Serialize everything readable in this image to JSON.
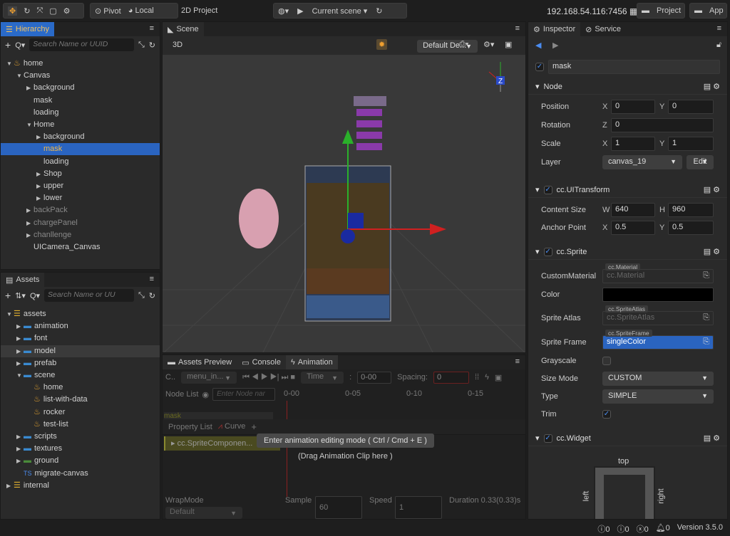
{
  "toolbar": {
    "pivot": "Pivot",
    "local": "Local",
    "project_type": "2D Project",
    "scene_select": "Current scene",
    "ip": "192.168.54.116:7456",
    "project_btn": "Project",
    "app_btn": "App"
  },
  "hierarchy": {
    "tab": "Hierarchy",
    "search_placeholder": "Search Name or UUID",
    "items": [
      {
        "label": "home",
        "depth": 0,
        "arrow": "down",
        "icon": true
      },
      {
        "label": "Canvas",
        "depth": 1,
        "arrow": "down"
      },
      {
        "label": "background",
        "depth": 2,
        "arrow": "right"
      },
      {
        "label": "mask",
        "depth": 2
      },
      {
        "label": "loading",
        "depth": 2
      },
      {
        "label": "Home",
        "depth": 2,
        "arrow": "down"
      },
      {
        "label": "background",
        "depth": 3,
        "arrow": "right"
      },
      {
        "label": "mask",
        "depth": 3,
        "selected": true
      },
      {
        "label": "loading",
        "depth": 3
      },
      {
        "label": "Shop",
        "depth": 3,
        "arrow": "right"
      },
      {
        "label": "upper",
        "depth": 3,
        "arrow": "right"
      },
      {
        "label": "lower",
        "depth": 3,
        "arrow": "right"
      },
      {
        "label": "backPack",
        "depth": 2,
        "arrow": "right",
        "dim": true
      },
      {
        "label": "chargePanel",
        "depth": 2,
        "arrow": "right",
        "dim": true
      },
      {
        "label": "chanllenge",
        "depth": 2,
        "arrow": "right",
        "dim": true
      },
      {
        "label": "UICamera_Canvas",
        "depth": 2
      }
    ]
  },
  "assets": {
    "tab": "Assets",
    "search_placeholder": "Search Name or UU",
    "items": [
      {
        "label": "assets",
        "depth": 0,
        "arrow": "down",
        "type": "db"
      },
      {
        "label": "animation",
        "depth": 1,
        "arrow": "right",
        "type": "folder"
      },
      {
        "label": "font",
        "depth": 1,
        "arrow": "right",
        "type": "folder"
      },
      {
        "label": "model",
        "depth": 1,
        "arrow": "right",
        "type": "folder",
        "highlight": true
      },
      {
        "label": "prefab",
        "depth": 1,
        "arrow": "right",
        "type": "folder"
      },
      {
        "label": "scene",
        "depth": 1,
        "arrow": "down",
        "type": "folder"
      },
      {
        "label": "home",
        "depth": 2,
        "type": "scene"
      },
      {
        "label": "list-with-data",
        "depth": 2,
        "type": "scene"
      },
      {
        "label": "rocker",
        "depth": 2,
        "type": "scene"
      },
      {
        "label": "test-list",
        "depth": 2,
        "type": "scene"
      },
      {
        "label": "scripts",
        "depth": 1,
        "arrow": "right",
        "type": "folder"
      },
      {
        "label": "textures",
        "depth": 1,
        "arrow": "right",
        "type": "folder"
      },
      {
        "label": "ground",
        "depth": 1,
        "arrow": "right",
        "type": "image"
      },
      {
        "label": "migrate-canvas",
        "depth": 1,
        "type": "ts"
      },
      {
        "label": "internal",
        "depth": 0,
        "arrow": "right",
        "type": "db"
      }
    ]
  },
  "scene": {
    "tab": "Scene",
    "mode": "3D",
    "camera_select": "Default De...",
    "gizmo_axis": "Z"
  },
  "animation": {
    "tabs": [
      "Assets Preview",
      "Console",
      "Animation"
    ],
    "clip_label": "C..",
    "clip_select": "menu_in...",
    "time_select": "Time",
    "time_value": "0-00",
    "spacing_label": "Spacing:",
    "spacing_value": "0",
    "node_list": "Node List",
    "node_placeholder": "Enter Node nar",
    "ticks": [
      "0-00",
      "0-05",
      "0-10",
      "0-15"
    ],
    "node_row": "mask",
    "property_list": "Property List",
    "curve": "Curve",
    "property": "cc.SpriteComponen...",
    "tooltip": "Enter animation editing mode ( Ctrl / Cmd + E )",
    "drag_hint": "(Drag Animation Clip here )",
    "wrapmode_label": "WrapMode",
    "wrapmode_value": "Default",
    "sample_label": "Sample",
    "sample_value": "60",
    "speed_label": "Speed",
    "speed_value": "1",
    "duration_label": "Duration",
    "duration_value": "0.33(0.33)s"
  },
  "inspector": {
    "tabs": [
      "Inspector",
      "Service"
    ],
    "node_name": "mask",
    "node_section": "Node",
    "position": {
      "label": "Position",
      "x": "0",
      "y": "0"
    },
    "rotation": {
      "label": "Rotation",
      "z": "0"
    },
    "scale": {
      "label": "Scale",
      "x": "1",
      "y": "1"
    },
    "layer": {
      "label": "Layer",
      "value": "canvas_19",
      "edit": "Edit"
    },
    "uitransform": {
      "title": "cc.UITransform",
      "content_size_label": "Content Size",
      "w": "640",
      "h": "960",
      "anchor_label": "Anchor Point",
      "ax": "0.5",
      "ay": "0.5"
    },
    "sprite": {
      "title": "cc.Sprite",
      "custom_material_label": "CustomMaterial",
      "material_tag": "cc.Material",
      "material_value": "cc.Material",
      "color_label": "Color",
      "color_value": "#000000",
      "atlas_label": "Sprite Atlas",
      "atlas_tag": "cc.SpriteAtlas",
      "atlas_value": "cc.SpriteAtlas",
      "frame_label": "Sprite Frame",
      "frame_tag": "cc.SpriteFrame",
      "frame_value": "singleColor",
      "grayscale_label": "Grayscale",
      "grayscale": false,
      "size_mode_label": "Size Mode",
      "size_mode": "CUSTOM",
      "type_label": "Type",
      "type": "SIMPLE",
      "trim_label": "Trim",
      "trim": true
    },
    "widget": {
      "title": "cc.Widget",
      "top": "top",
      "left": "left",
      "right": "right"
    }
  },
  "status": {
    "info": "0",
    "warn": "0",
    "error": "0",
    "notify": "0",
    "version": "Version 3.5.0"
  },
  "colors": {
    "accent": "#2a64c0",
    "selected_text": "#f0b84a",
    "bg": "#2a2a2a"
  }
}
